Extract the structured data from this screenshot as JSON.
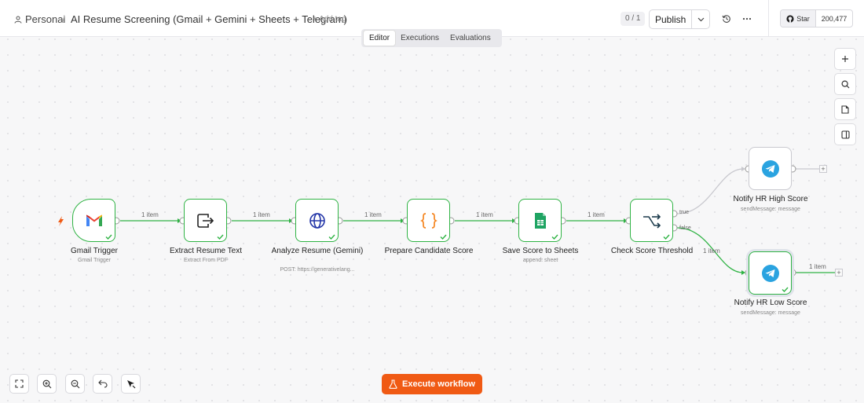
{
  "header": {
    "project": "Personal",
    "separator": "/",
    "workflow_title": "AI Resume Screening (Gmail + Gemini + Sheets + Telegram)",
    "add_tag": "+ Add tag",
    "counter": "0 / 1",
    "publish_label": "Publish",
    "github_star_label": "Star",
    "github_star_count": "200,477"
  },
  "tabs": [
    {
      "label": "Editor",
      "active": true
    },
    {
      "label": "Executions",
      "active": false
    },
    {
      "label": "Evaluations",
      "active": false
    }
  ],
  "nodes": [
    {
      "title": "Gmail Trigger",
      "subtitle": "Gmail Trigger",
      "icon": "gmail-icon",
      "status": "success"
    },
    {
      "title": "Extract Resume Text",
      "subtitle": "Extract From PDF",
      "icon": "extract-file-icon",
      "status": "success"
    },
    {
      "title": "Analyze Resume (Gemini)",
      "subtitle": "POST: https://generativelang...",
      "icon": "globe-icon",
      "status": "success"
    },
    {
      "title": "Prepare Candidate Score",
      "subtitle": "",
      "icon": "code-braces-icon",
      "status": "success"
    },
    {
      "title": "Save Score to Sheets",
      "subtitle": "append: sheet",
      "icon": "google-sheets-icon",
      "status": "success"
    },
    {
      "title": "Check Score Threshold",
      "subtitle": "",
      "icon": "if-branch-icon",
      "status": "success"
    },
    {
      "title": "Notify HR High Score",
      "subtitle": "sendMessage: message",
      "icon": "telegram-icon",
      "status": "idle"
    },
    {
      "title": "Notify HR Low Score",
      "subtitle": "sendMessage: message",
      "icon": "telegram-icon",
      "status": "success"
    }
  ],
  "edges": {
    "item_label": "1 item",
    "true_label": "true",
    "false_label": "false"
  },
  "execute_label": "Execute workflow",
  "colors": {
    "success": "#2fb344",
    "accent": "#f05a14",
    "telegram": "#2aa3e0",
    "sheets": "#1fa463"
  }
}
